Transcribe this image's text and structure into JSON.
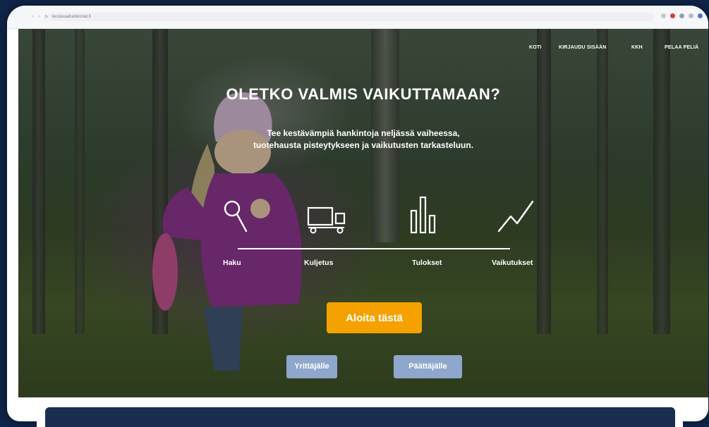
{
  "browser": {
    "url": "kestavaahankinnat.fi",
    "nav_symbols": [
      "‹",
      "›",
      "⟳"
    ]
  },
  "nav": {
    "items": [
      "KOTI",
      "KIRJAUDU SISÄÄN",
      "KKH",
      "PELAA PELIÄ"
    ]
  },
  "hero": {
    "title": "OLETKO VALMIS VAIKUTTAMAAN?",
    "subtitle_line1": "Tee kestävämpiä hankintoja neljässä vaiheessa,",
    "subtitle_line2": "tuotehausta pisteytykseen ja vaikutusten tarkasteluun."
  },
  "steps": [
    {
      "label": "Haku",
      "icon": "magnifier-icon"
    },
    {
      "label": "Kuljetus",
      "icon": "truck-icon"
    },
    {
      "label": "Tulokset",
      "icon": "bar-chart-icon"
    },
    {
      "label": "Vaikutukset",
      "icon": "trend-line-icon"
    }
  ],
  "cta": {
    "label": "Aloita tästä",
    "color": "#f5a200"
  },
  "audience_buttons": [
    {
      "label": "Yrittäjälle"
    },
    {
      "label": "Päättäjälle"
    }
  ],
  "colors": {
    "background": "#10264a",
    "secondary_button": "#8fa7cc",
    "bottom_panel": "#1b2d4f"
  }
}
